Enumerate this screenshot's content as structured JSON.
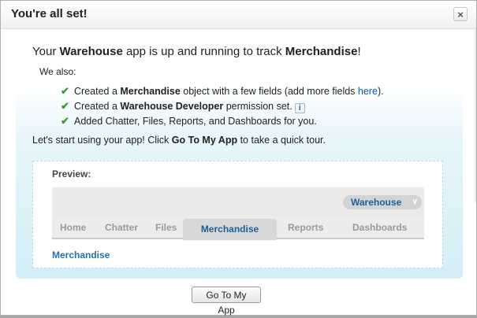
{
  "dialog": {
    "title": "You're all set!",
    "close_label": "×"
  },
  "headline": {
    "prefix": "Your ",
    "app_name": "Warehouse",
    "middle": " app is up and running to track ",
    "object_name": "Merchandise",
    "suffix": "!"
  },
  "we_also": "We also:",
  "checklist": {
    "icon": "checkmark-icon",
    "glyph": "✔",
    "items": [
      {
        "pre": "Created a ",
        "bold": "Merchandise",
        "post": " object with a few fields (add more fields ",
        "link": "here",
        "end": ")."
      },
      {
        "pre": "Created a ",
        "bold": "Warehouse Developer",
        "post": " permission set.",
        "info_glyph": "i"
      },
      {
        "text": "Added Chatter, Files, Reports, and Dashboards for you."
      }
    ]
  },
  "lets_start": {
    "prefix": "Let's start using your app! Click ",
    "bold": "Go To My App",
    "suffix": " to take a quick tour."
  },
  "preview": {
    "label": "Preview:",
    "app_selector": "Warehouse",
    "chevron": "∨",
    "tabs": [
      "Home",
      "Chatter",
      "Files",
      "Merchandise",
      "Reports",
      "Dashboards"
    ],
    "active_tab": "Merchandise",
    "crumb": "Merchandise"
  },
  "button": {
    "label": "Go To My App"
  },
  "colors": {
    "link": "#015ba7",
    "check": "#3d9b35",
    "active_tab_text": "#1d5f99"
  }
}
